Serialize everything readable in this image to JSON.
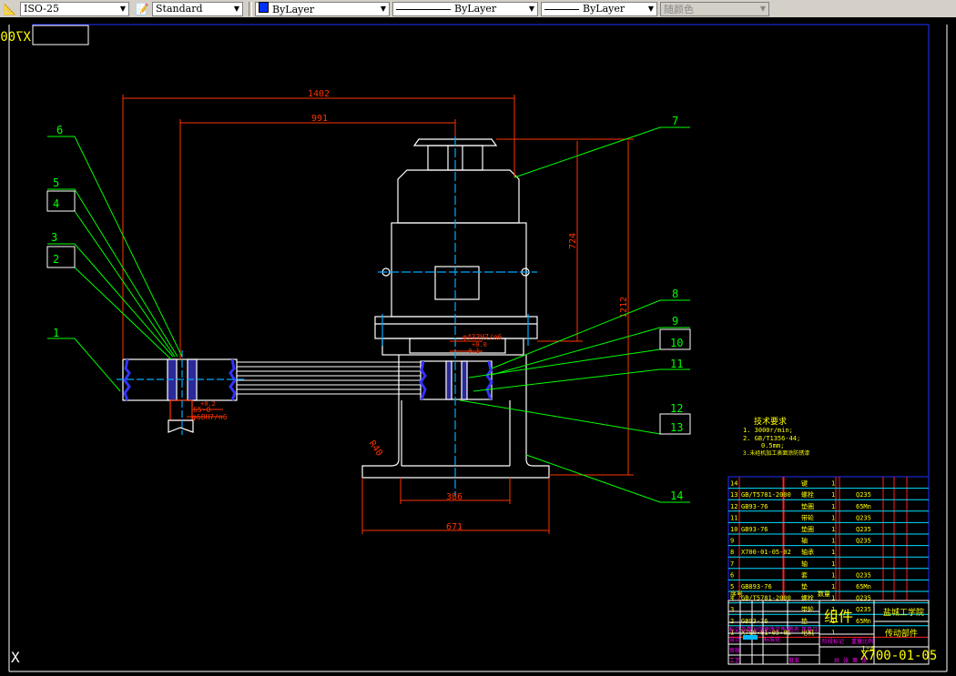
{
  "toolbar": {
    "dimstyle": "ISO-25",
    "textstyle": "Standard",
    "color": "ByLayer",
    "linetype": "ByLayer",
    "lineweight": "ByLayer",
    "plotstyle": "随颜色",
    "colors": {
      "layer_swatch": "#0030ff"
    }
  },
  "drawing": {
    "mirrored_title": "X700-01-05",
    "dimensions": {
      "d1402": "1402",
      "d991": "991",
      "d724": "724",
      "d1212": "1212",
      "d386": "386",
      "d671": "671",
      "r40": "R40",
      "fit_right": "φ433H7/n6",
      "tol_right_up": "+0.0",
      "tol_right_dn": "-0.1",
      "fit_left": "φ68H7/n6",
      "tol_left_up": "+0.2",
      "tol_left_dn": "65-0"
    },
    "leaders": [
      "1",
      "2",
      "3",
      "4",
      "5",
      "6",
      "7",
      "8",
      "9",
      "10",
      "11",
      "12",
      "13",
      "14"
    ],
    "colors": {
      "outline": "#ffffff",
      "dimension": "#ff3300",
      "center": "#00aaff",
      "leader": "#00ff00",
      "hatch": "#3333ff",
      "text": "#ffff00",
      "label": "#ff00ff"
    }
  },
  "tech_requirements": {
    "title": "技术要求",
    "lines": [
      "1.  3000r/min;",
      "2.  GB/T1356-44;",
      "0.5mm;",
      "3.未经机加工表面涂防锈漆"
    ]
  },
  "parts_list": {
    "rows": [
      {
        "no": "14",
        "code": "",
        "name": "键",
        "qty": "1",
        "material": ""
      },
      {
        "no": "13",
        "code": "GB/T5781-2000",
        "name": "螺栓",
        "qty": "1",
        "material": "Q235"
      },
      {
        "no": "12",
        "code": "GB93-76",
        "name": "垫圈",
        "qty": "1",
        "material": "65Mn"
      },
      {
        "no": "11",
        "code": "",
        "name": "带轮",
        "qty": "1",
        "material": "Q235"
      },
      {
        "no": "10",
        "code": "GB93-76",
        "name": "垫圈",
        "qty": "1",
        "material": "Q235"
      },
      {
        "no": "9",
        "code": "",
        "name": "轴",
        "qty": "1",
        "material": "Q235"
      },
      {
        "no": "8",
        "code": "X700-01-05-02",
        "name": "轴承",
        "qty": "1",
        "material": ""
      },
      {
        "no": "7",
        "code": "",
        "name": "轴",
        "qty": "1",
        "material": ""
      },
      {
        "no": "6",
        "code": "",
        "name": "套",
        "qty": "1",
        "material": "Q235"
      },
      {
        "no": "5",
        "code": "GB893-76",
        "name": "垫",
        "qty": "1",
        "material": "65Mn"
      },
      {
        "no": "4",
        "code": "GB/T5781-2000",
        "name": "螺栓",
        "qty": "1",
        "material": "Q235"
      },
      {
        "no": "3",
        "code": "",
        "name": "带轮",
        "qty": "1",
        "material": "Q235"
      },
      {
        "no": "2",
        "code": "GB93-76",
        "name": "垫",
        "qty": "1",
        "material": "65Mn"
      },
      {
        "no": "1",
        "code": "X700-01-05-01",
        "name": "电机",
        "qty": "1",
        "material": ""
      }
    ],
    "header": {
      "no": "序号",
      "qty": "数量"
    }
  },
  "title_block": {
    "assembly": "组件",
    "school": "盐城工学院",
    "part_name": "传动部件",
    "drawing_no": "X700-01-05",
    "scale": "1:4",
    "labels": [
      "标记",
      "处数",
      "分区",
      "更改文件号",
      "签名",
      "年月日",
      "设计",
      "标准化",
      "阶段标记",
      "重量",
      "比例",
      "审核",
      "工艺",
      "批准",
      "共",
      "张",
      "第",
      "张"
    ]
  }
}
